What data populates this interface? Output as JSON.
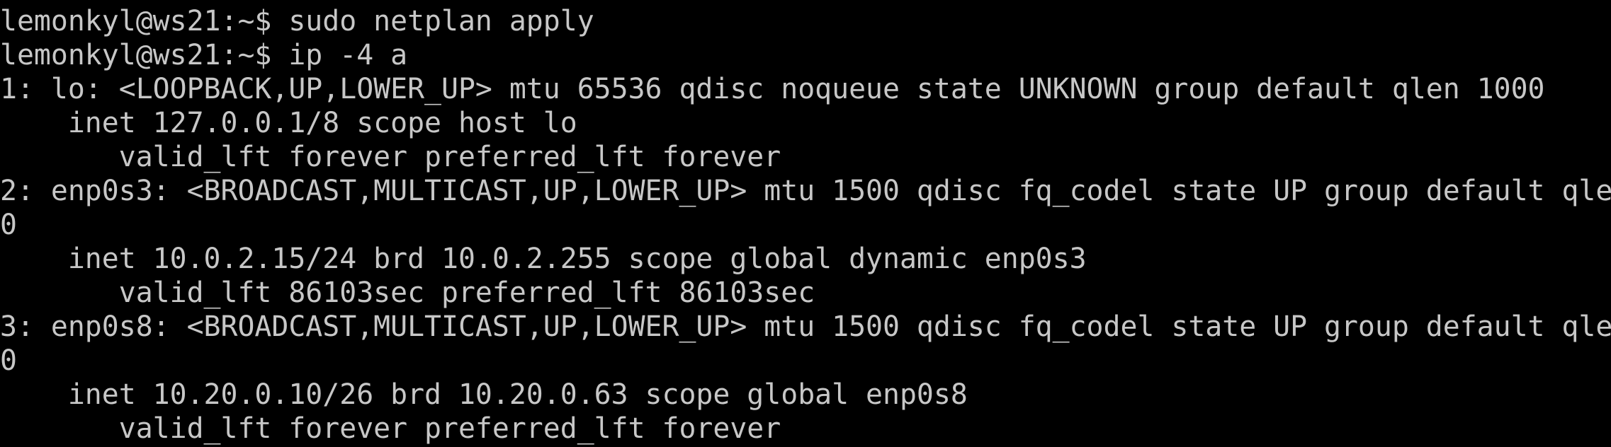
{
  "terminal": {
    "background": "#000000",
    "foreground": "#c7c7c7",
    "lines": [
      "lemonkyl@ws21:~$ sudo netplan apply",
      "lemonkyl@ws21:~$ ip -4 a",
      "1: lo: <LOOPBACK,UP,LOWER_UP> mtu 65536 qdisc noqueue state UNKNOWN group default qlen 1000",
      "    inet 127.0.0.1/8 scope host lo",
      "       valid_lft forever preferred_lft forever",
      "2: enp0s3: <BROADCAST,MULTICAST,UP,LOWER_UP> mtu 1500 qdisc fq_codel state UP group default qle",
      "0",
      "    inet 10.0.2.15/24 brd 10.0.2.255 scope global dynamic enp0s3",
      "       valid_lft 86103sec preferred_lft 86103sec",
      "3: enp0s8: <BROADCAST,MULTICAST,UP,LOWER_UP> mtu 1500 qdisc fq_codel state UP group default qle",
      "0",
      "    inet 10.20.0.10/26 brd 10.20.0.63 scope global enp0s8",
      "       valid_lft forever preferred_lft forever"
    ]
  }
}
